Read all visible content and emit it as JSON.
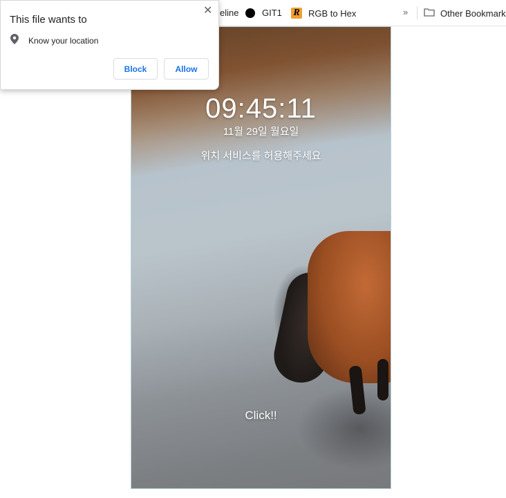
{
  "bookmarks": {
    "items": [
      {
        "label": "eline",
        "icon": "none"
      },
      {
        "label": "GIT1",
        "icon": "black-circle-icon"
      },
      {
        "label": "RGB to Hex",
        "icon": "r-logo-icon",
        "icon_letter": "R"
      },
      {
        "label": "Other Bookmarks",
        "icon": "folder-icon"
      }
    ],
    "more": "»"
  },
  "lockscreen": {
    "time": "09:45:11",
    "date": "11월 29일 월요일",
    "message": "위치 서비스를 허용해주세요",
    "click_label": "Click!!"
  },
  "popup": {
    "title": "This file wants to",
    "close_glyph": "✕",
    "permission": "Know your location",
    "block_label": "Block",
    "allow_label": "Allow"
  },
  "colors": {
    "accent": "#1a73e8",
    "rgb_icon_bg": "#f0a030"
  }
}
